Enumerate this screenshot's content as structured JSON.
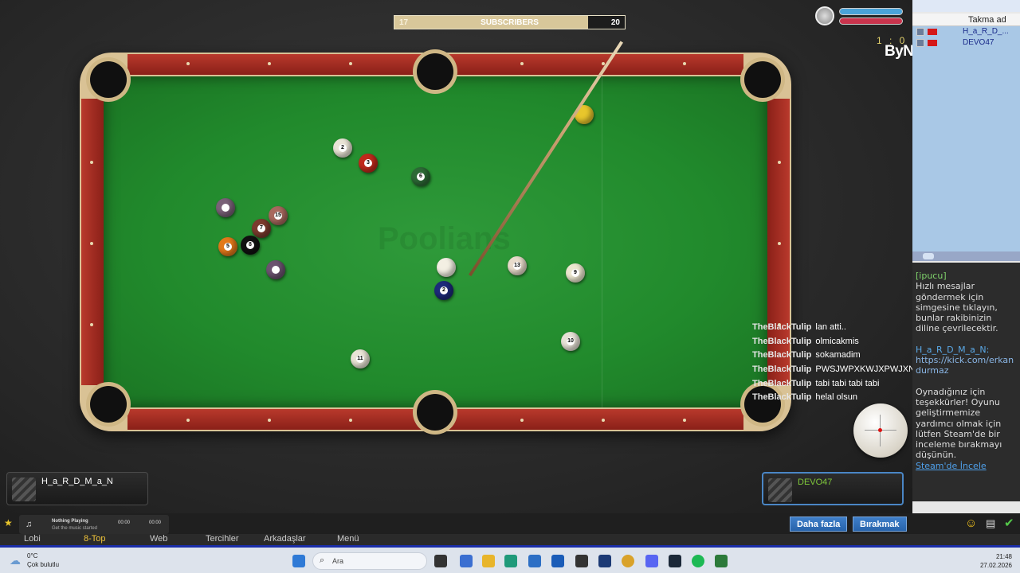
{
  "subscribers": {
    "current": "17",
    "label": "SUBSCRIBERS",
    "goal": "20"
  },
  "game": {
    "watermark": "Poolians",
    "score": "1 : 0",
    "logo": "ByNoGame",
    "player_left": "H_a_R_D_M_a_N",
    "player_right": "DEVO47"
  },
  "chat": [
    {
      "who": "TheBlackTulip",
      "msg": "lan atti.."
    },
    {
      "who": "TheBlackTulip",
      "msg": "olmicakmis"
    },
    {
      "who": "TheBlackTulip",
      "msg": "sokamadim"
    },
    {
      "who": "TheBlackTulip",
      "msg": "PWSJWPXKWJXPWJXN"
    },
    {
      "who": "TheBlackTulip",
      "msg": "tabi tabi tabi tabi"
    },
    {
      "who": "TheBlackTulip",
      "msg": "helal olsun"
    }
  ],
  "sidebar": {
    "header": "Takma ad",
    "players": [
      "H_a_R_D_...",
      "DEVO47"
    ],
    "tip_label": "[ipucu]",
    "tip_text": "Hızlı mesajlar göndermek için simgesine tıklayın, bunlar rakibinizin diline çevrilecektir.",
    "user": "H_a_R_D_M_a_N:",
    "user_link": "https://kick.com/erkandurmaz",
    "thanks": "Oynadığınız için teşekkürler! Oyunu geliştirmemize yardımcı olmak için lütfen Steam'de bir inceleme bırakmayı düşünün.",
    "steam_link": "Steam'de İncele"
  },
  "bottom": {
    "tabs": [
      "Lobi",
      "8-Top",
      "Web",
      "Tercihler",
      "Arkadaşlar",
      "Menü"
    ],
    "more": "Daha fazla",
    "quit": "Bırakmak",
    "music_title": "Nothing Playing",
    "music_sub": "Get the music started",
    "music_t1": "00:00",
    "music_t2": "00:00"
  },
  "taskbar": {
    "temp": "0°C",
    "weather": "Çok bulutlu",
    "search": "Ara",
    "time": "21:48",
    "date": "27.02.2026"
  },
  "colors": {
    "felt": "#218a2c",
    "rail": "#a52a20",
    "accent": "#2763ab"
  }
}
